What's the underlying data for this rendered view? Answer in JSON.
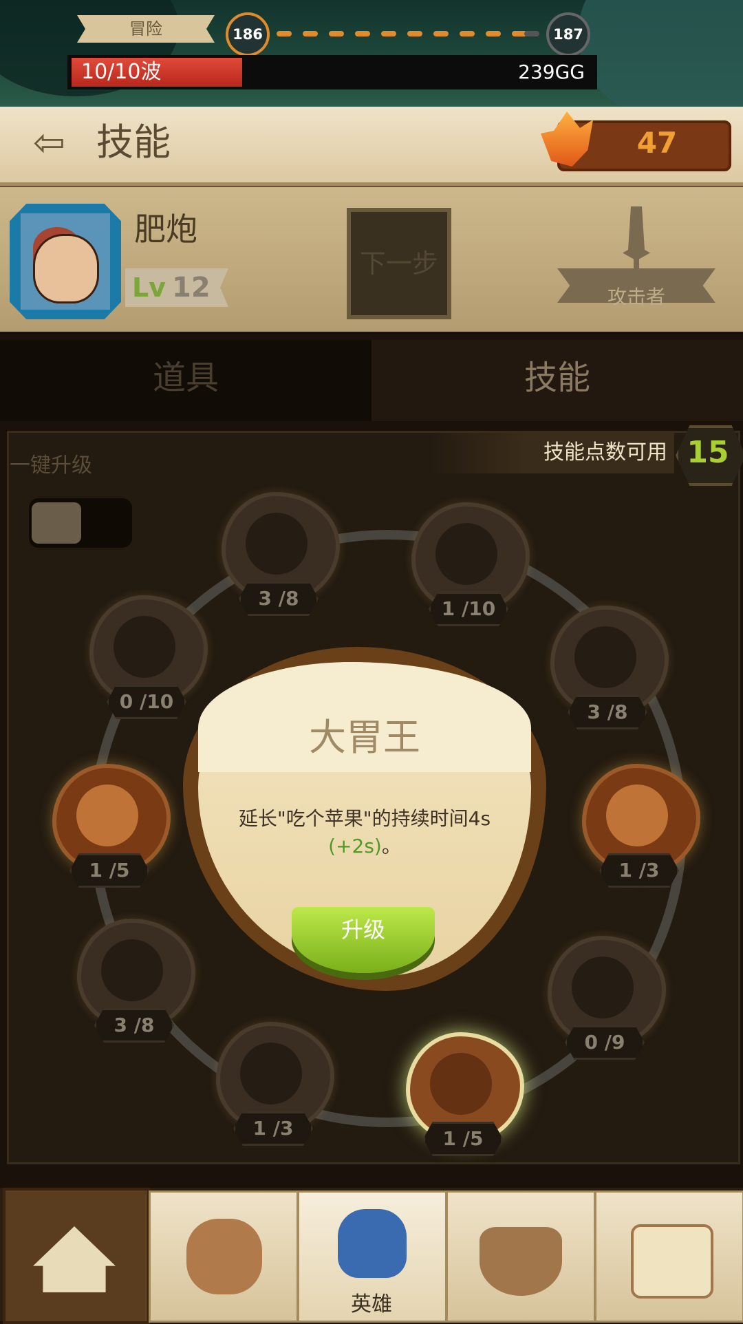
{
  "top": {
    "adventure_label": "冒险",
    "current_node": "186",
    "next_node": "187",
    "wave_text": "10/10波",
    "gold_text": "239GG"
  },
  "header": {
    "title": "技能",
    "gem_count": "47"
  },
  "hero": {
    "name": "肥炮",
    "level_tag": "Lv",
    "level": "12",
    "next_label": "下一步",
    "role": "攻击者"
  },
  "tabs": {
    "items": "道具",
    "skills": "技能"
  },
  "skill_panel": {
    "points_label": "技能点数可用",
    "points": "15",
    "auto_upgrade_label": "一键升级",
    "skills": [
      {
        "name": "muscle-skill",
        "count": "3 /8"
      },
      {
        "name": "pumpkin-skill",
        "count": "1 /10"
      },
      {
        "name": "scale-skill",
        "count": "0 /10"
      },
      {
        "name": "island-skill",
        "count": "3 /8"
      },
      {
        "name": "apple-skill",
        "count": "1 /5"
      },
      {
        "name": "explosion-skill",
        "count": "1 /3"
      },
      {
        "name": "cockroach-skill",
        "count": "3 /8"
      },
      {
        "name": "heart-target-skill",
        "count": "0 /9"
      },
      {
        "name": "egg-skill",
        "count": "1 /3"
      },
      {
        "name": "glutton-skill",
        "count": "1 /5"
      }
    ]
  },
  "popup": {
    "title": "大胃王",
    "desc": "延长\"吃个苹果\"的持续时间4s",
    "desc_bonus": "(+2s)",
    "desc_end": "。",
    "upgrade_label": "升级"
  },
  "nav": {
    "hero_label": "英雄"
  }
}
